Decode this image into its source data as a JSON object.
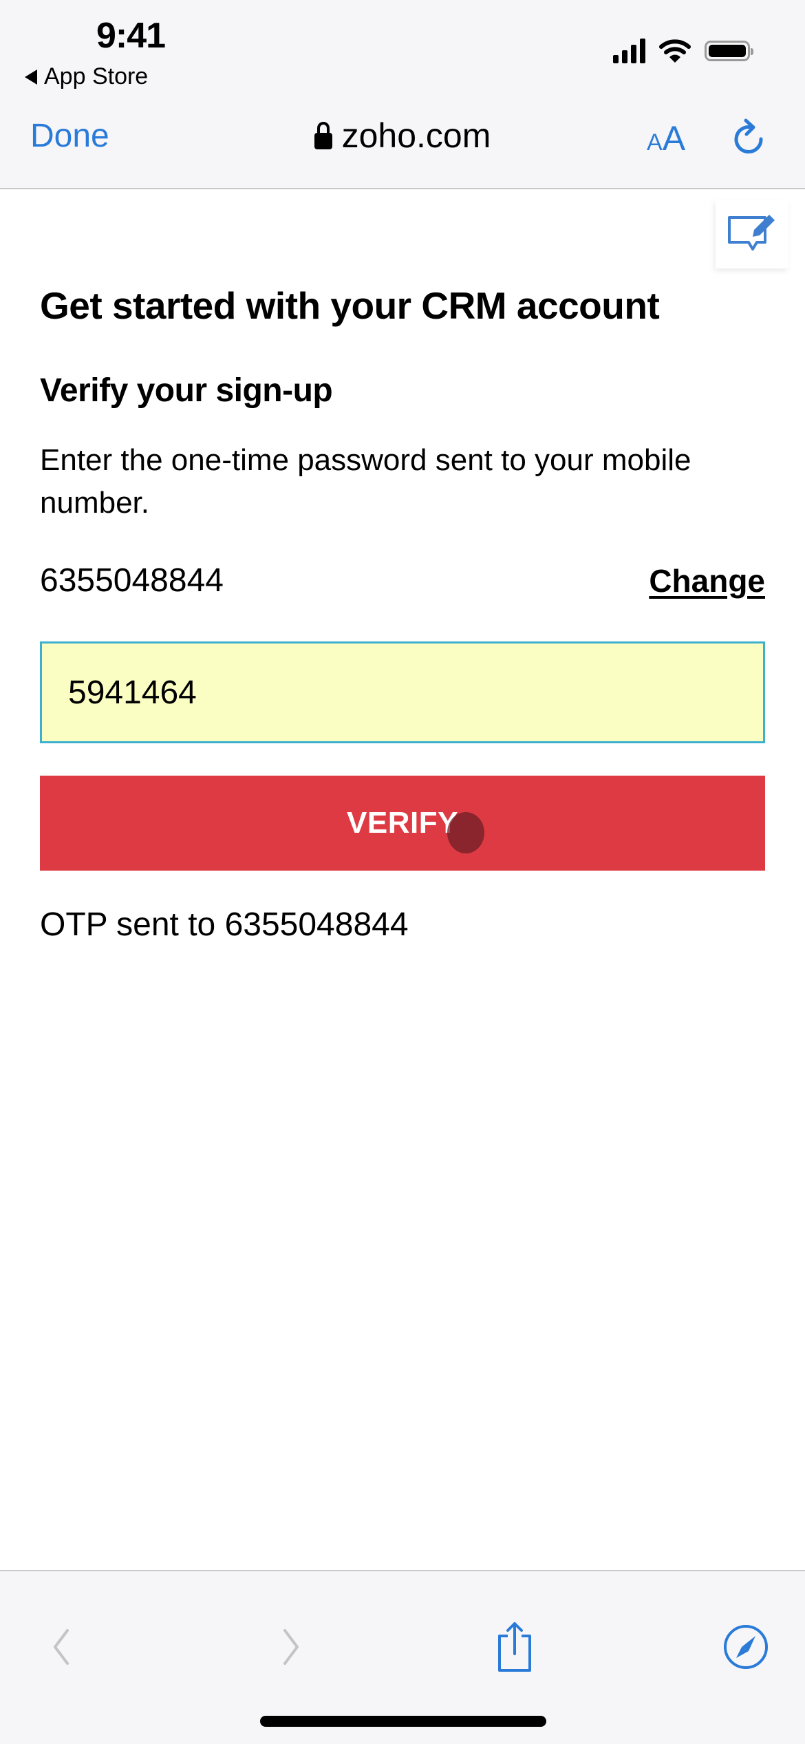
{
  "status_bar": {
    "time": "9:41",
    "back_label": "App Store",
    "icons": [
      "cellular-signal-icon",
      "wifi-icon",
      "battery-icon"
    ]
  },
  "browser": {
    "done_label": "Done",
    "domain": "zoho.com",
    "text_size_small": "A",
    "text_size_big": "A",
    "icons": [
      "lock-icon",
      "text-size-icon",
      "reload-icon"
    ]
  },
  "page": {
    "title": "Get started with your CRM account",
    "subtitle": "Verify your sign-up",
    "description": "Enter the one-time password sent to your mobile number.",
    "phone_number": "6355048844",
    "change_label": "Change",
    "otp_value": "5941464",
    "verify_label": "VERIFY",
    "otp_sent_message": "OTP sent to 6355048844",
    "feedback_icon": "feedback-edit-icon"
  },
  "bottom_toolbar": {
    "items": [
      "back-icon",
      "forward-icon",
      "share-icon",
      "compass-icon"
    ]
  },
  "colors": {
    "ios_blue": "#2a7bd8",
    "verify_red": "#de3a43",
    "input_bg": "#fafec2",
    "input_border": "#3eb0cf"
  }
}
